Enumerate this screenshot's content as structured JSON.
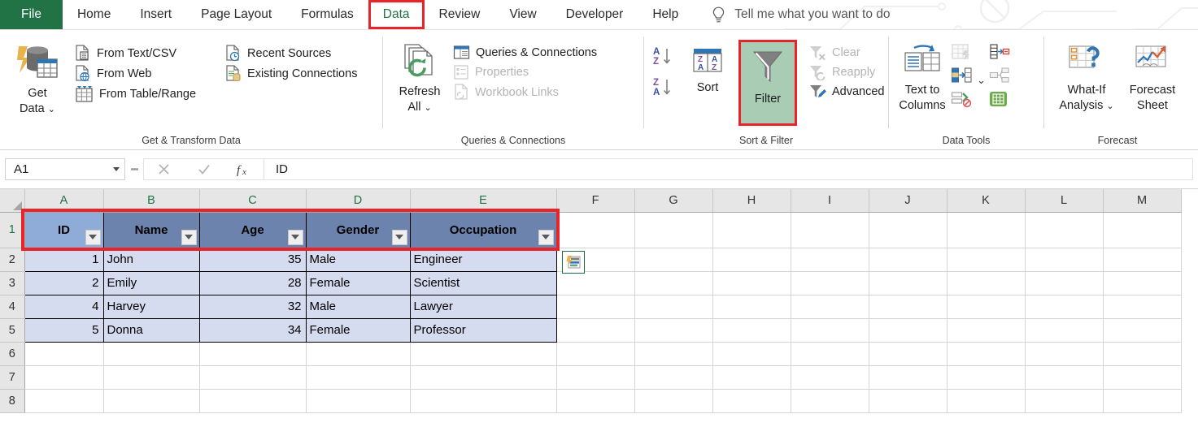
{
  "tabs": [
    {
      "label": "File",
      "kind": "file"
    },
    {
      "label": "Home",
      "kind": "normal"
    },
    {
      "label": "Insert",
      "kind": "normal"
    },
    {
      "label": "Page Layout",
      "kind": "normal"
    },
    {
      "label": "Formulas",
      "kind": "normal"
    },
    {
      "label": "Data",
      "kind": "active"
    },
    {
      "label": "Review",
      "kind": "normal"
    },
    {
      "label": "View",
      "kind": "normal"
    },
    {
      "label": "Developer",
      "kind": "normal"
    },
    {
      "label": "Help",
      "kind": "normal"
    }
  ],
  "tellme": {
    "label": "Tell me what you want to do",
    "icon": "lightbulb-icon"
  },
  "ribbon": {
    "groups": [
      {
        "label": "Get & Transform Data",
        "big": {
          "label_line1": "Get",
          "label_line2": "Data",
          "caret": true,
          "icon": "get-data-icon"
        },
        "items": [
          {
            "label": "From Text/CSV",
            "icon": "from-text-csv-icon",
            "disabled": false
          },
          {
            "label": "From Web",
            "icon": "from-web-icon",
            "disabled": false
          },
          {
            "label": "From Table/Range",
            "icon": "from-table-range-icon",
            "disabled": false
          },
          {
            "label": "Recent Sources",
            "icon": "recent-sources-icon",
            "disabled": false
          },
          {
            "label": "Existing Connections",
            "icon": "existing-connections-icon",
            "disabled": false
          }
        ]
      },
      {
        "label": "Queries & Connections",
        "big": {
          "label_line1": "Refresh",
          "label_line2": "All",
          "caret": true,
          "icon": "refresh-all-icon"
        },
        "items": [
          {
            "label": "Queries & Connections",
            "icon": "queries-connections-icon",
            "disabled": false
          },
          {
            "label": "Properties",
            "icon": "properties-icon",
            "disabled": true
          },
          {
            "label": "Workbook Links",
            "icon": "workbook-links-icon",
            "disabled": true
          }
        ]
      },
      {
        "label": "Sort & Filter",
        "sort_label": "Sort",
        "filter_label": "Filter",
        "filter_active": true,
        "items": [
          {
            "label": "Clear",
            "icon": "clear-filter-icon",
            "disabled": true
          },
          {
            "label": "Reapply",
            "icon": "reapply-filter-icon",
            "disabled": true
          },
          {
            "label": "Advanced",
            "icon": "advanced-filter-icon",
            "disabled": false
          }
        ]
      },
      {
        "label": "Data Tools",
        "big": {
          "label_line1": "Text to",
          "label_line2": "Columns",
          "caret": false,
          "icon": "text-to-columns-icon"
        },
        "small_icons": [
          {
            "name": "flash-fill-icon",
            "disabled": true
          },
          {
            "name": "data-validation-icon",
            "disabled": false
          },
          {
            "name": "remove-duplicates-icon",
            "disabled": false
          },
          {
            "name": "consolidate-icon",
            "disabled": true
          },
          {
            "name": "relationships-icon",
            "disabled": false
          },
          {
            "name": "manage-data-model-icon",
            "disabled": false
          }
        ]
      },
      {
        "label": "Forecast",
        "buttons": [
          {
            "label_line1": "What-If",
            "label_line2": "Analysis",
            "caret": true,
            "icon": "what-if-analysis-icon"
          },
          {
            "label_line1": "Forecast",
            "label_line2": "Sheet",
            "caret": false,
            "icon": "forecast-sheet-icon"
          }
        ]
      }
    ]
  },
  "formula_bar": {
    "name_box_value": "A1",
    "cancel_icon": "cancel-icon",
    "enter_icon": "confirm-icon",
    "fx_icon": "insert-function-icon",
    "content": "ID"
  },
  "grid": {
    "columns": [
      {
        "label": "A",
        "width": 97,
        "selected": true
      },
      {
        "label": "B",
        "width": 118,
        "selected": true
      },
      {
        "label": "C",
        "width": 131,
        "selected": true
      },
      {
        "label": "D",
        "width": 128,
        "selected": true
      },
      {
        "label": "E",
        "width": 180,
        "selected": true
      },
      {
        "label": "F",
        "width": 96,
        "selected": false
      },
      {
        "label": "G",
        "width": 96,
        "selected": false
      },
      {
        "label": "H",
        "width": 96,
        "selected": false
      },
      {
        "label": "I",
        "width": 96,
        "selected": false
      },
      {
        "label": "J",
        "width": 96,
        "selected": false
      },
      {
        "label": "K",
        "width": 96,
        "selected": false
      },
      {
        "label": "L",
        "width": 96,
        "selected": false
      },
      {
        "label": "M",
        "width": 96,
        "selected": false
      }
    ],
    "header_row_number": "1",
    "headers": [
      "ID",
      "Name",
      "Age",
      "Gender",
      "Occupation"
    ],
    "active_cell": "A1",
    "rows": [
      {
        "num": "2",
        "cells": [
          "1",
          "John",
          "35",
          "Male",
          "Engineer"
        ]
      },
      {
        "num": "3",
        "cells": [
          "2",
          "Emily",
          "28",
          "Female",
          "Scientist"
        ]
      },
      {
        "num": "4",
        "cells": [
          "4",
          "Harvey",
          "32",
          "Male",
          "Lawyer"
        ]
      },
      {
        "num": "5",
        "cells": [
          "5",
          "Donna",
          "34",
          "Female",
          "Professor"
        ]
      }
    ],
    "empty_rows": [
      "6",
      "7",
      "8"
    ],
    "numeric_columns": [
      0,
      2
    ],
    "quick_analysis_icon": "quick-analysis-icon",
    "filter_dropdown_icon": "filter-dropdown-icon"
  },
  "colors": {
    "file_tab_green": "#217346",
    "annotation_red": "#e8232a",
    "filter_highlight_green": "#a8cdb4",
    "header_fill": "#6c83ad",
    "active_header_fill": "#8fabd8",
    "data_fill": "#d6dcef"
  }
}
